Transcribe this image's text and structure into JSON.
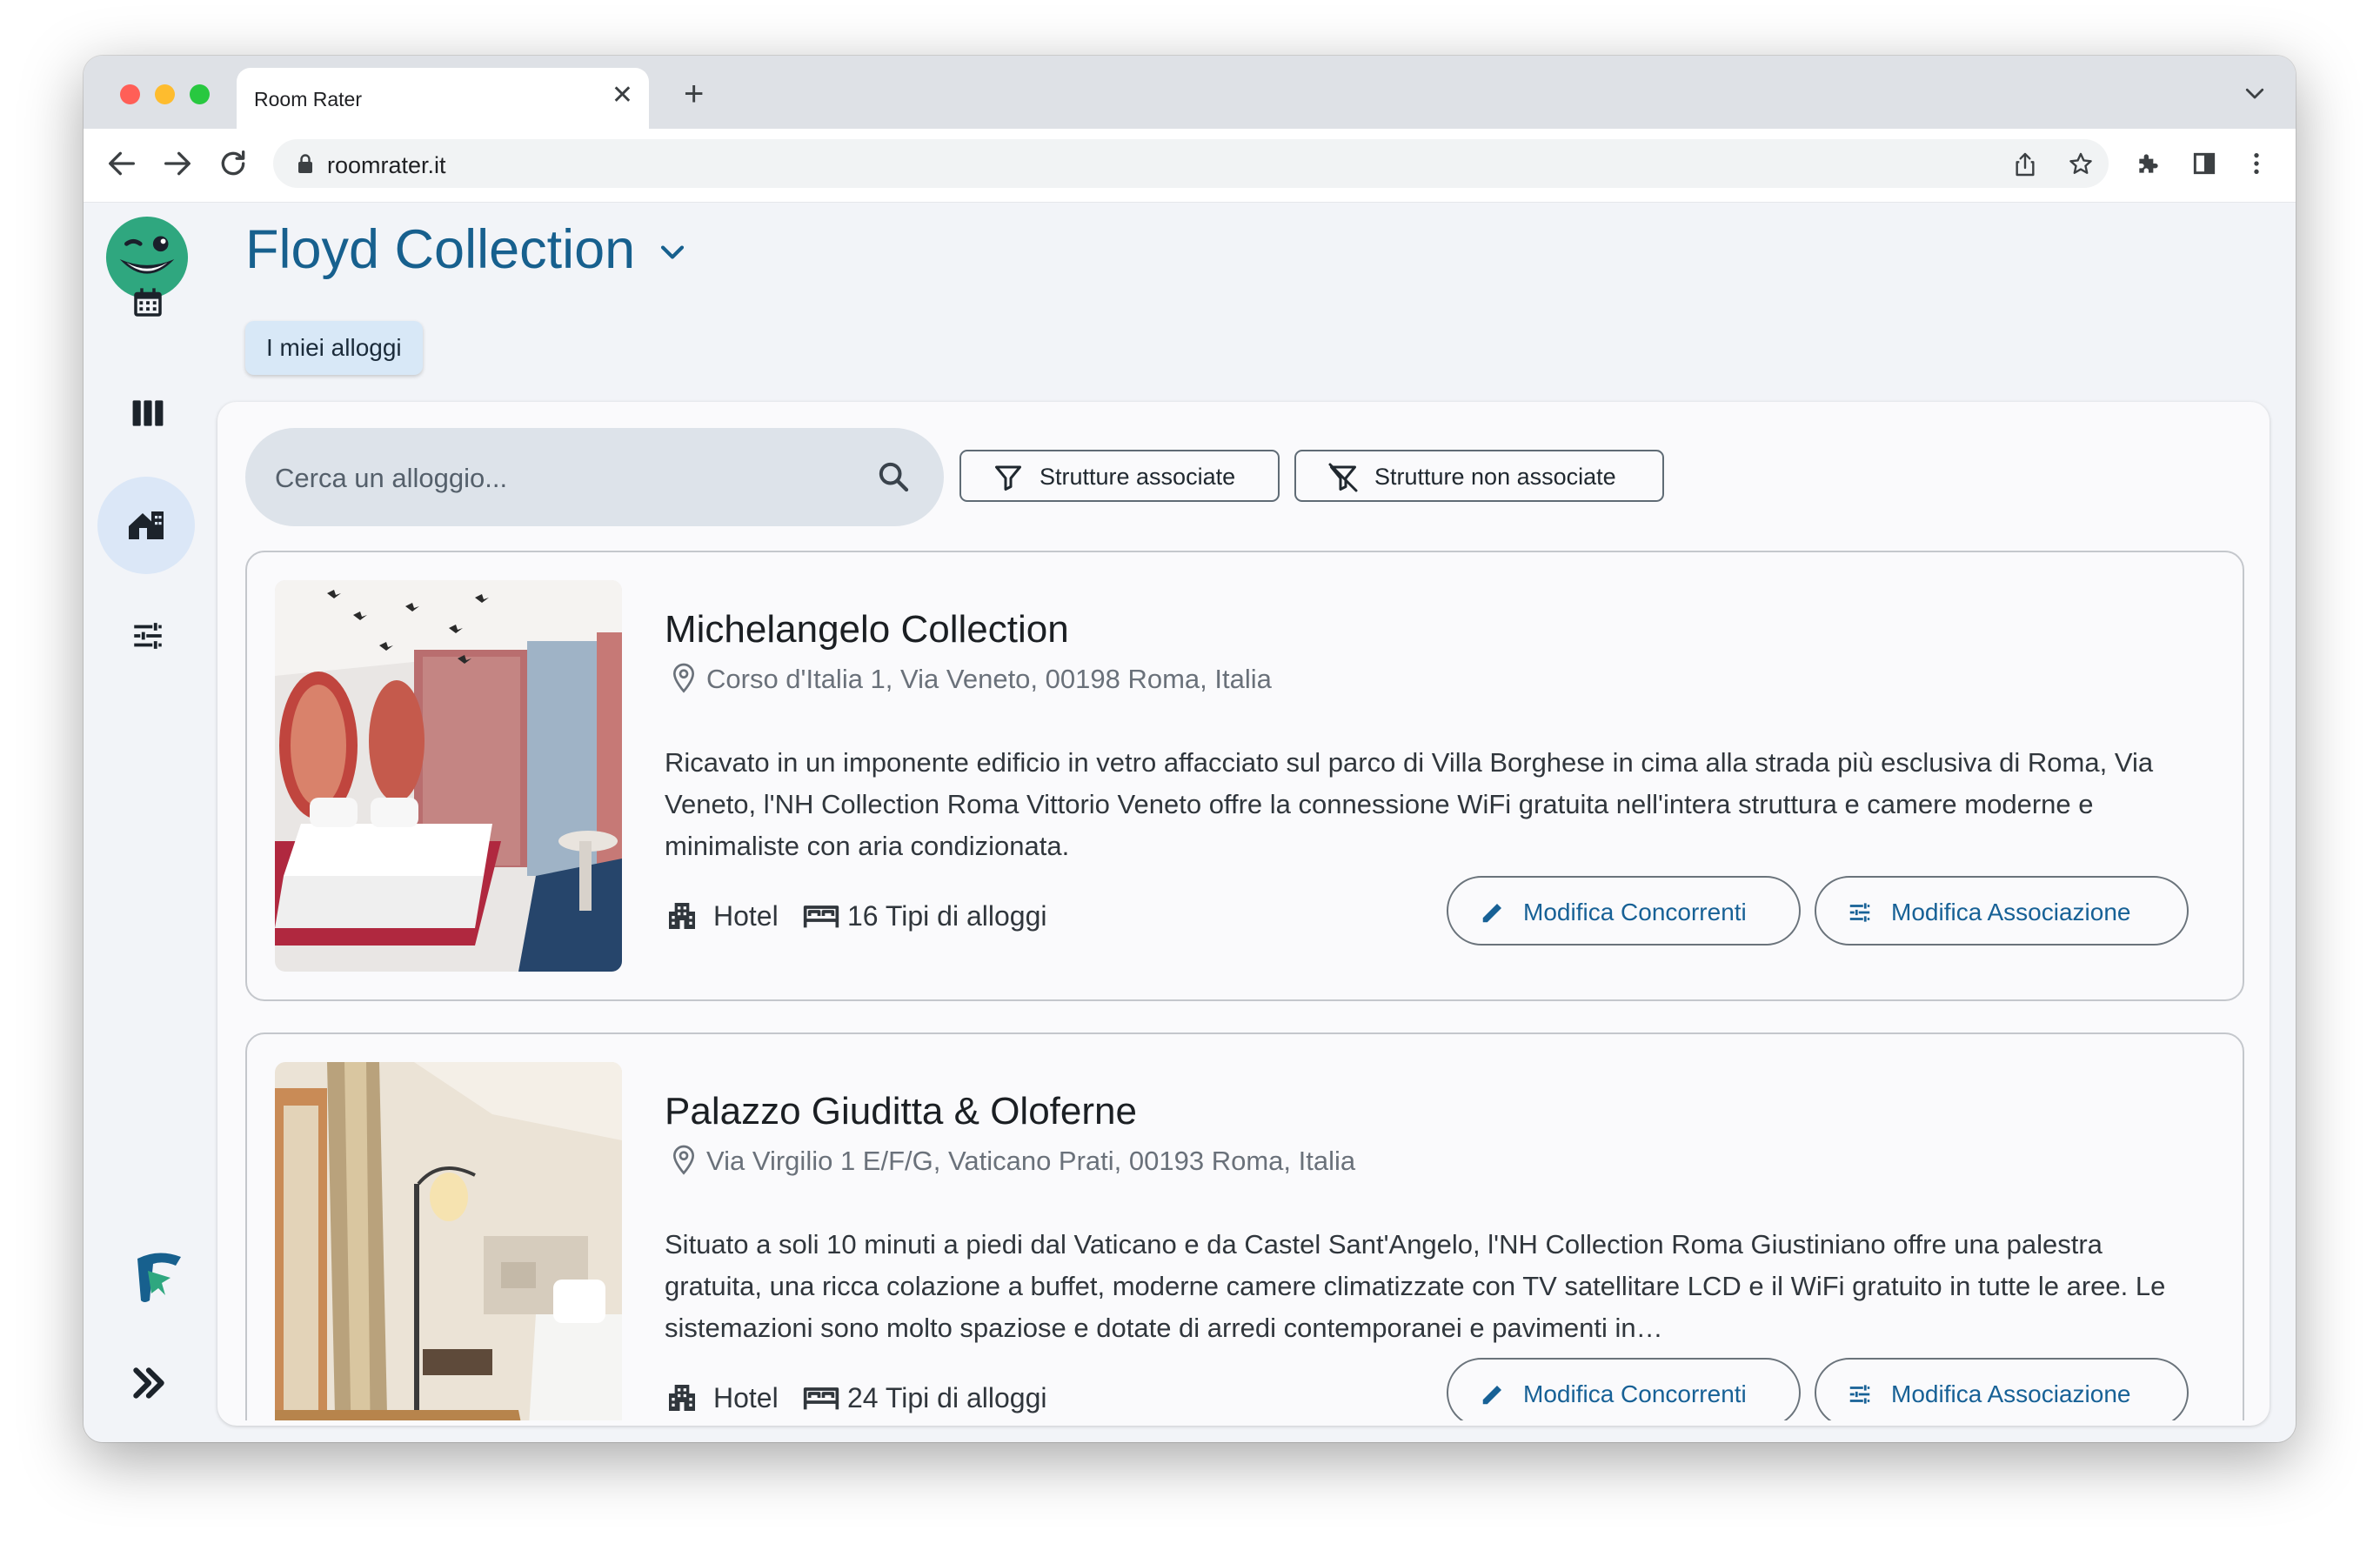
{
  "browser": {
    "tab_title": "Room Rater",
    "url": "roomrater.it"
  },
  "app": {
    "collection_title": "Floyd Collection",
    "active_tab": "I miei alloggi",
    "search_placeholder": "Cerca un alloggio...",
    "filters": {
      "associated": "Strutture associate",
      "not_associated": "Strutture non associate"
    }
  },
  "properties": [
    {
      "name": "Michelangelo Collection",
      "address": "Corso d'Italia 1, Via Veneto, 00198 Roma, Italia",
      "description": "Ricavato in un imponente edificio in vetro affacciato sul parco di Villa Borghese in cima alla strada più esclusiva di Roma, Via Veneto, l'NH Collection Roma Vittorio Veneto offre la connessione WiFi gratuita nell'intera struttura e camere moderne e minimaliste con aria condizionata.",
      "type": "Hotel",
      "room_types": "16 Tipi di alloggi",
      "edit_competitors": "Modifica Concorrenti",
      "edit_association": "Modifica Associazione"
    },
    {
      "name": "Palazzo Giuditta & Oloferne",
      "address": "Via Virgilio 1 E/F/G, Vaticano Prati, 00193 Roma, Italia",
      "description": "Situato a soli 10 minuti a piedi dal Vaticano e da Castel Sant'Angelo, l'NH Collection Roma Giustiniano offre una palestra gratuita, una ricca colazione a buffet, moderne camere climatizzate con TV satellitare LCD e il WiFi gratuito in tutte le aree. Le sistemazioni sono molto spaziose e dotate di arredi contemporanei e pavimenti in…",
      "type": "Hotel",
      "room_types": "24 Tipi di alloggi",
      "edit_competitors": "Modifica Concorrenti",
      "edit_association": "Modifica Associazione"
    }
  ],
  "icons": {
    "rail": [
      "calendar-icon",
      "columns-icon",
      "properties-icon",
      "tune-icon"
    ],
    "card": [
      "location-pin-icon",
      "building-icon",
      "bed-icon",
      "pencil-icon",
      "tune-icon"
    ]
  },
  "colors": {
    "title_blue": "#17608e",
    "action_blue": "#176196",
    "active_chip": "#d8e8f7",
    "logo_green": "#2fa77f"
  }
}
